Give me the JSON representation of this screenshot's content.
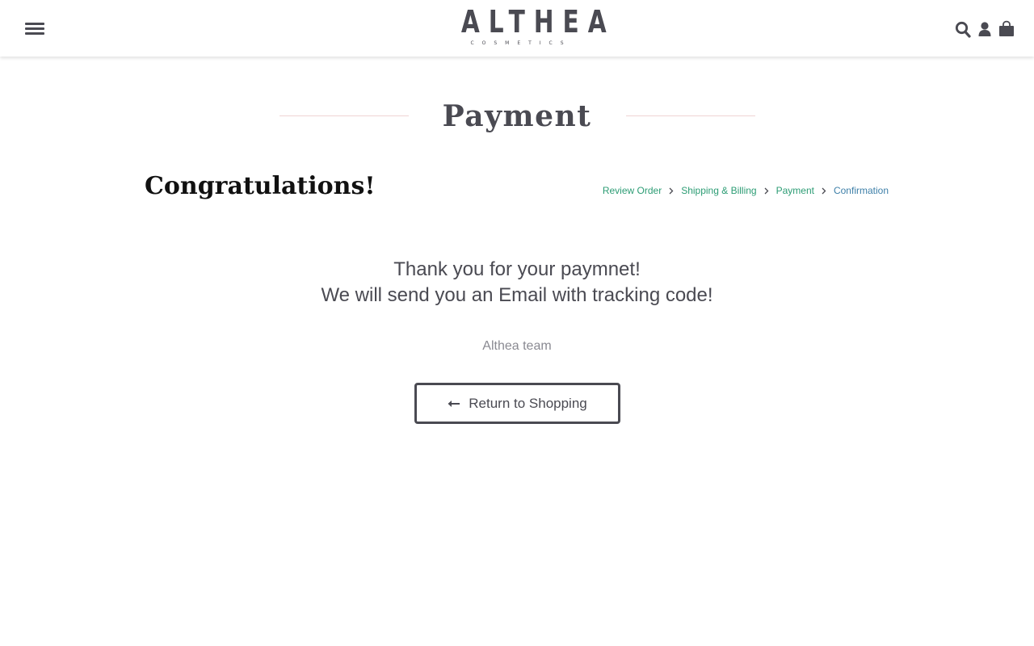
{
  "header": {
    "menu_icon": "hamburger-menu-icon",
    "logo": {
      "main": "ALTHEA",
      "sub": "COSMETICS"
    },
    "icons": [
      "search-icon",
      "user-icon",
      "shopping-bag-icon"
    ],
    "icon_color": "#4a4a52"
  },
  "page": {
    "title": "Payment",
    "heading": "Congratulations!"
  },
  "breadcrumb": {
    "items": [
      {
        "label": "Review Order"
      },
      {
        "label": "Shipping & Billing"
      },
      {
        "label": "Payment"
      },
      {
        "label": "Confirmation"
      }
    ],
    "link_color": "#2c9c74",
    "current_color": "#3d7fa8"
  },
  "message": {
    "line1": "Thank you for your paymnet!",
    "line2": "We will send you an Email with tracking code!",
    "signature": "Althea team"
  },
  "return_button": {
    "label": "Return to Shopping",
    "icon": "arrow-left-icon"
  }
}
